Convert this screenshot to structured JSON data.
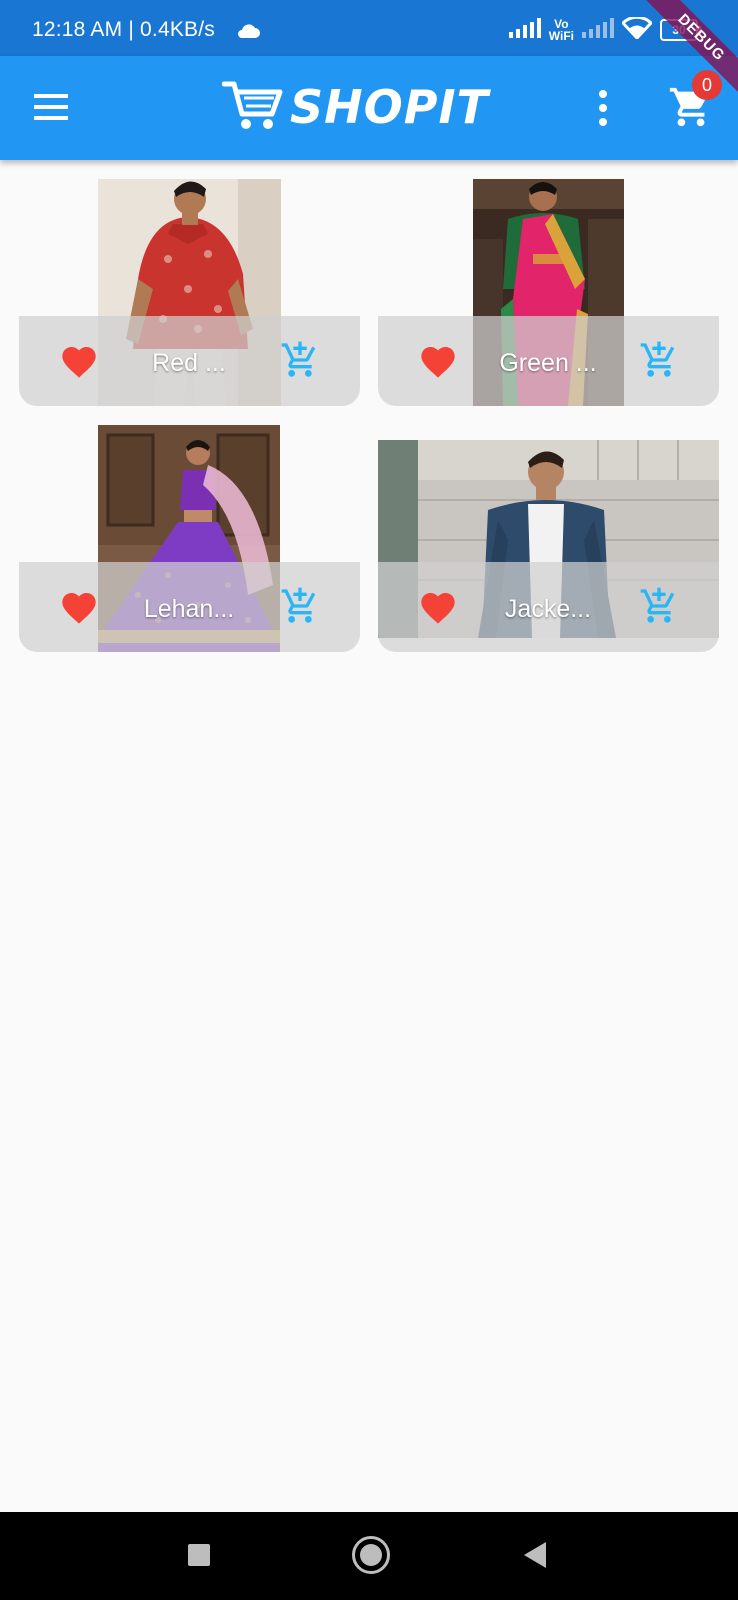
{
  "status_bar": {
    "time": "12:18 AM | 0.4KB/s",
    "vowifi_top": "Vo",
    "vowifi_bottom": "WiFi",
    "battery": "30"
  },
  "debug_banner": "DEBUG",
  "app_bar": {
    "title": "SHOPIT",
    "cart_count": "0",
    "colors": {
      "background": "#2196f3",
      "status_bar": "#1976d2",
      "badge": "#e53935"
    }
  },
  "products": [
    {
      "title": "Red ...",
      "image_icon": "shirt-photo",
      "favorite_icon": "heart-icon",
      "cart_icon": "add-shopping-cart-icon"
    },
    {
      "title": "Green ...",
      "image_icon": "saree-photo",
      "favorite_icon": "heart-icon",
      "cart_icon": "add-shopping-cart-icon"
    },
    {
      "title": "Lehan...",
      "image_icon": "lehanga-photo",
      "favorite_icon": "heart-icon",
      "cart_icon": "add-shopping-cart-icon"
    },
    {
      "title": "Jacke...",
      "image_icon": "jacket-photo",
      "favorite_icon": "heart-icon",
      "cart_icon": "add-shopping-cart-icon"
    }
  ],
  "accent_colors": {
    "heart": "#f44336",
    "cart_icon": "#29b6f6"
  }
}
